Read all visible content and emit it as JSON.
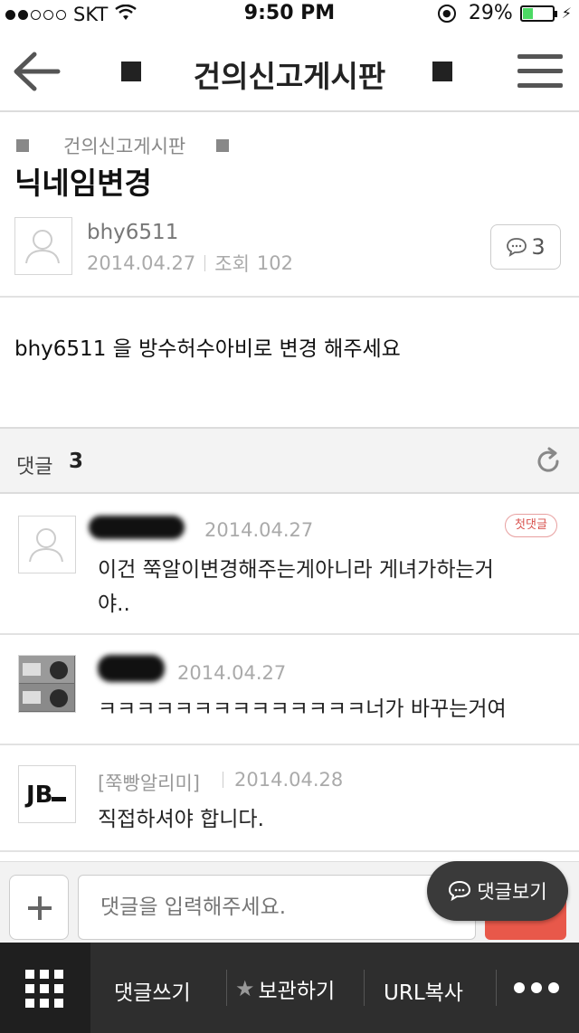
{
  "status": {
    "carrier": "SKT",
    "time": "9:50 PM",
    "battery": "29%",
    "battery_level": 0.29
  },
  "header": {
    "title": "건의신고게시판"
  },
  "post": {
    "breadcrumb": "건의신고게시판",
    "title": "닉네임변경",
    "author": "bhy6511",
    "date": "2014.04.27",
    "views_label": "조회",
    "views": "102",
    "comment_count": "3",
    "body": "bhy6511 을 방수허수아비로 변경 해주세요"
  },
  "comments": {
    "label": "댓글",
    "count": "3",
    "first_badge": "첫댓글",
    "items": [
      {
        "author": "",
        "date": "2014.04.27",
        "text_line1": "이건 쭉알이변경해주는게아니라 게녀가하는거",
        "text_line2": "야.."
      },
      {
        "author": "",
        "date": "2014.04.27",
        "text_line1": "ㅋㅋㅋㅋㅋㅋㅋㅋㅋㅋㅋㅋㅋㅋ너가 바꾸는거여"
      },
      {
        "author": "[쭉빵알리미]",
        "date": "2014.04.28",
        "text_line1": "직접하셔야 합니다.",
        "avatar_text": "JB"
      }
    ]
  },
  "input": {
    "placeholder": "댓글을 입력해주세요.",
    "view_comments": "댓글보기"
  },
  "toolbar": {
    "write_comment": "댓글쓰기",
    "bookmark": "보관하기",
    "copy_url": "URL복사"
  },
  "colors": {
    "accent_red": "#e8584a",
    "toolbar_bg": "#2e2e2e",
    "battery_green": "#4cd964"
  }
}
